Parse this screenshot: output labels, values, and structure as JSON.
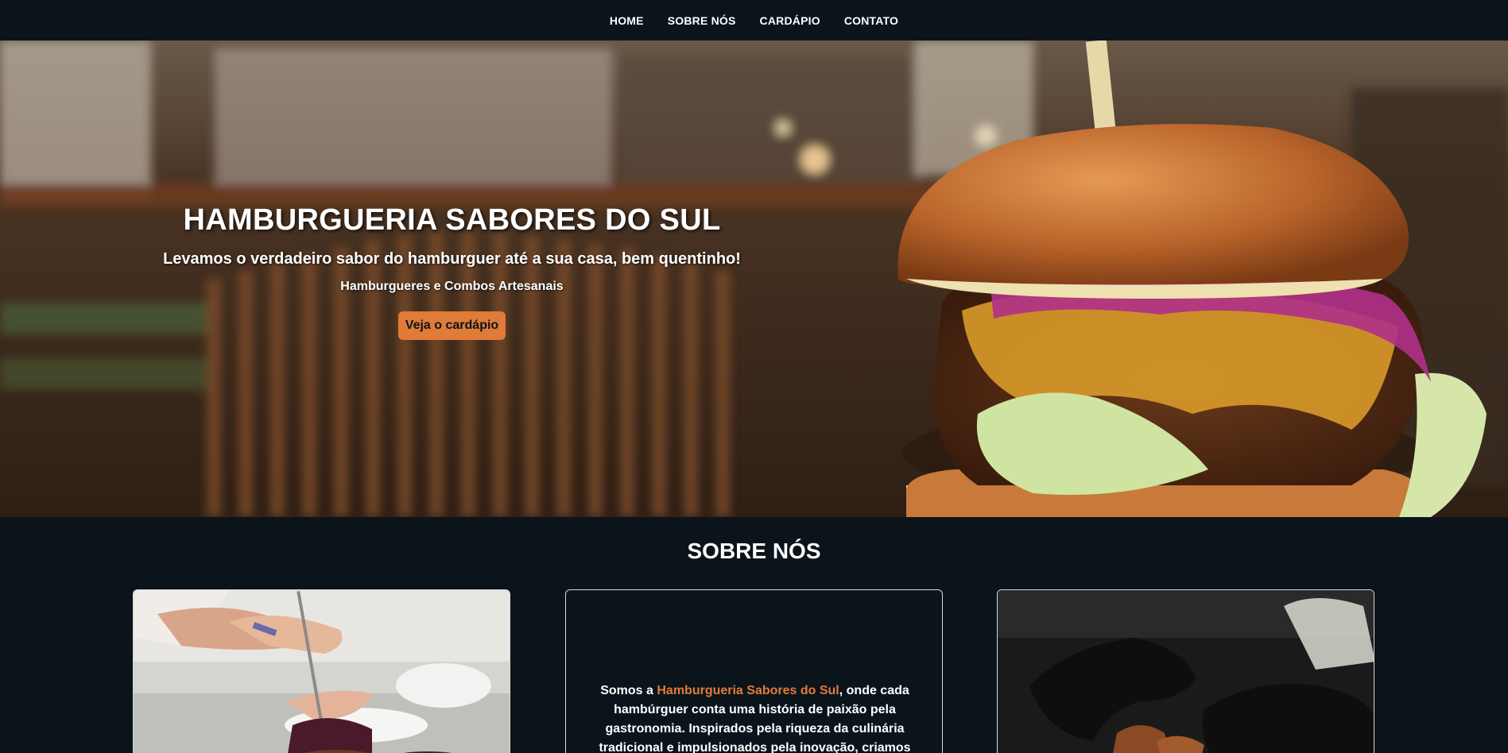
{
  "nav": {
    "items": [
      "HOME",
      "SOBRE NÓS",
      "CARDÁPIO",
      "CONTATO"
    ]
  },
  "hero": {
    "title": "HAMBURGUERIA SABORES DO SUL",
    "subtitle": "Levamos o verdadeiro sabor do hamburguer até a sua casa, bem quentinho!",
    "tagline": "Hamburgueres e Combos Artesanais",
    "cta_label": "Veja o cardápio"
  },
  "about": {
    "title": "SOBRE NÓS",
    "text_before": "Somos a ",
    "brand": "Hamburgueria Sabores do Sul",
    "text_after": ", onde cada hambúrguer conta uma história de paixão pela gastronomia. Inspirados pela riqueza da culinária tradicional e impulsionados pela inovação, criamos"
  },
  "colors": {
    "background": "#0b141a",
    "accent": "#e07b39",
    "text": "#ffffff"
  }
}
